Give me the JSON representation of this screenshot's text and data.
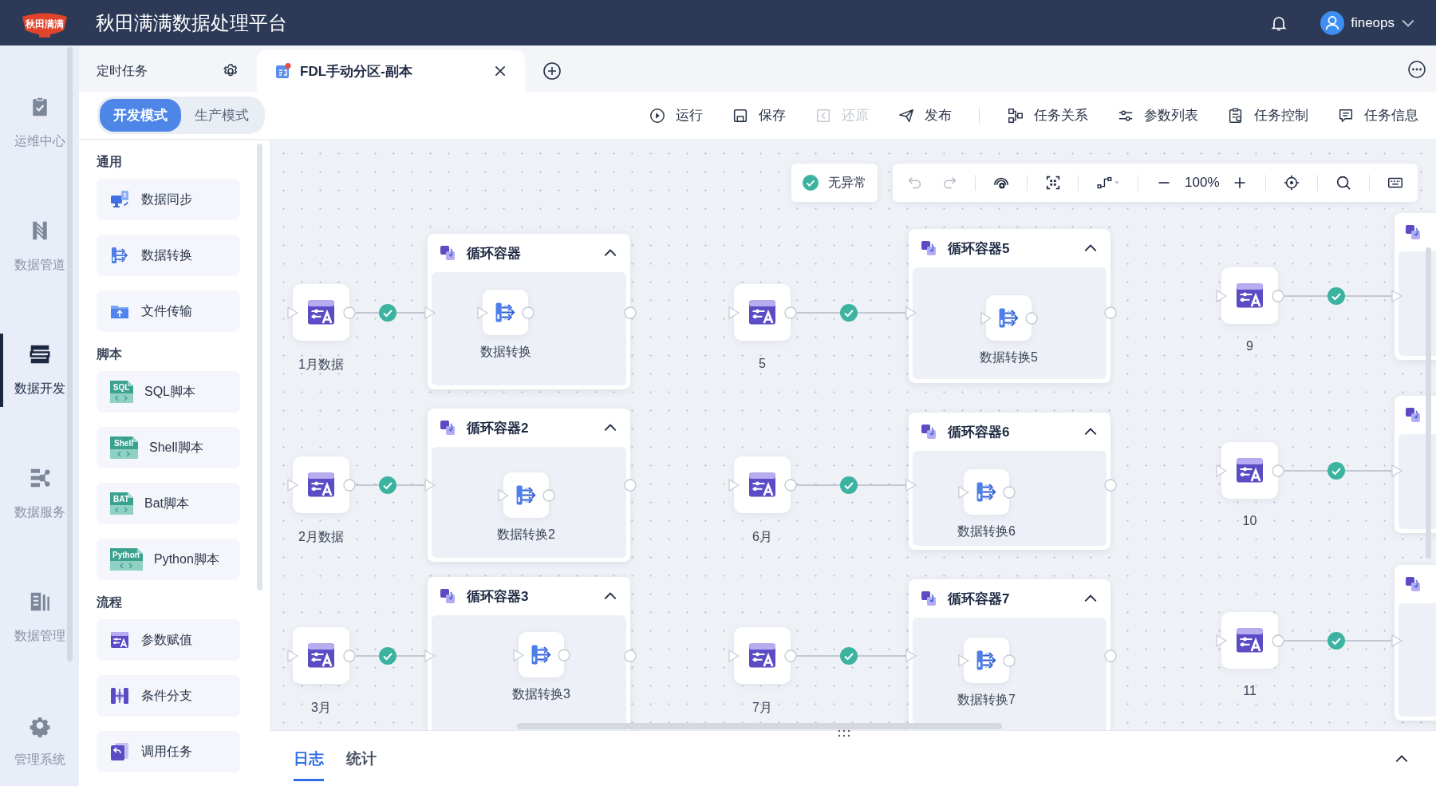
{
  "header": {
    "logo_text": "秋田满满",
    "title": "秋田满满数据处理平台",
    "user": "fineops"
  },
  "nav": [
    {
      "label": "运维中心",
      "selected": false
    },
    {
      "label": "数据管道",
      "selected": false
    },
    {
      "label": "数据开发",
      "selected": true
    },
    {
      "label": "数据服务",
      "selected": false
    },
    {
      "label": "数据管理",
      "selected": false
    },
    {
      "label": "管理系统",
      "selected": false
    }
  ],
  "tabs": [
    {
      "label": "定时任务",
      "kind": "folder",
      "selected": false
    },
    {
      "label": "FDL手动分区-副本",
      "kind": "task",
      "selected": true,
      "unsaved": true
    }
  ],
  "modes": [
    {
      "label": "开发模式",
      "selected": true
    },
    {
      "label": "生产模式",
      "selected": false
    }
  ],
  "actions": [
    {
      "label": "运行",
      "disabled": false
    },
    {
      "label": "保存",
      "disabled": false
    },
    {
      "label": "还原",
      "disabled": true
    },
    {
      "label": "发布",
      "disabled": false
    },
    {
      "label": "任务关系",
      "disabled": false
    },
    {
      "label": "参数列表",
      "disabled": false
    },
    {
      "label": "任务控制",
      "disabled": false
    },
    {
      "label": "任务信息",
      "disabled": false
    }
  ],
  "palette": [
    {
      "heading": "通用",
      "items": [
        {
          "label": "数据同步",
          "kind": "sync"
        },
        {
          "label": "数据转换",
          "kind": "transform"
        },
        {
          "label": "文件传输",
          "kind": "file"
        }
      ]
    },
    {
      "heading": "脚本",
      "items": [
        {
          "label": "SQL脚本",
          "kind": "script",
          "badge": "SQL"
        },
        {
          "label": "Shell脚本",
          "kind": "script",
          "badge": "Shell"
        },
        {
          "label": "Bat脚本",
          "kind": "script",
          "badge": "BAT"
        },
        {
          "label": "Python脚本",
          "kind": "script",
          "badge": "Python"
        }
      ]
    },
    {
      "heading": "流程",
      "items": [
        {
          "label": "参数赋值",
          "kind": "param"
        },
        {
          "label": "条件分支",
          "kind": "branch"
        },
        {
          "label": "调用任务",
          "kind": "call"
        }
      ]
    }
  ],
  "canvas": {
    "check_status": "无异常",
    "zoom": "100%",
    "rows": [
      {
        "source": {
          "label": "1月数据",
          "link_ok": true
        },
        "loop": {
          "title": "循环容器",
          "expanded": true,
          "task": "数据转换"
        },
        "middle": {
          "label": "5",
          "link_ok": true
        },
        "loop_2": {
          "title": "循环容器5",
          "expanded": true,
          "task": "数据转换5"
        },
        "end": {
          "label": "9",
          "link_ok": true
        }
      },
      {
        "source": {
          "label": "2月数据",
          "link_ok": true
        },
        "loop": {
          "title": "循环容器2",
          "expanded": true,
          "task": "数据转换2"
        },
        "middle": {
          "label": "6月",
          "link_ok": true
        },
        "loop_2": {
          "title": "循环容器6",
          "expanded": true,
          "task": "数据转换6"
        },
        "end": {
          "label": "10",
          "link_ok": true
        }
      },
      {
        "source": {
          "label": "3月",
          "link_ok": true
        },
        "loop": {
          "title": "循环容器3",
          "expanded": true,
          "task": "数据转换3"
        },
        "middle": {
          "label": "7月",
          "link_ok": true
        },
        "loop_2": {
          "title": "循环容器7",
          "expanded": true,
          "task": "数据转换7"
        },
        "end": {
          "label": "11",
          "link_ok": true
        }
      }
    ]
  },
  "bottom_panel": {
    "tabs": [
      {
        "label": "日志",
        "selected": true
      },
      {
        "label": "统计",
        "selected": false
      }
    ]
  }
}
